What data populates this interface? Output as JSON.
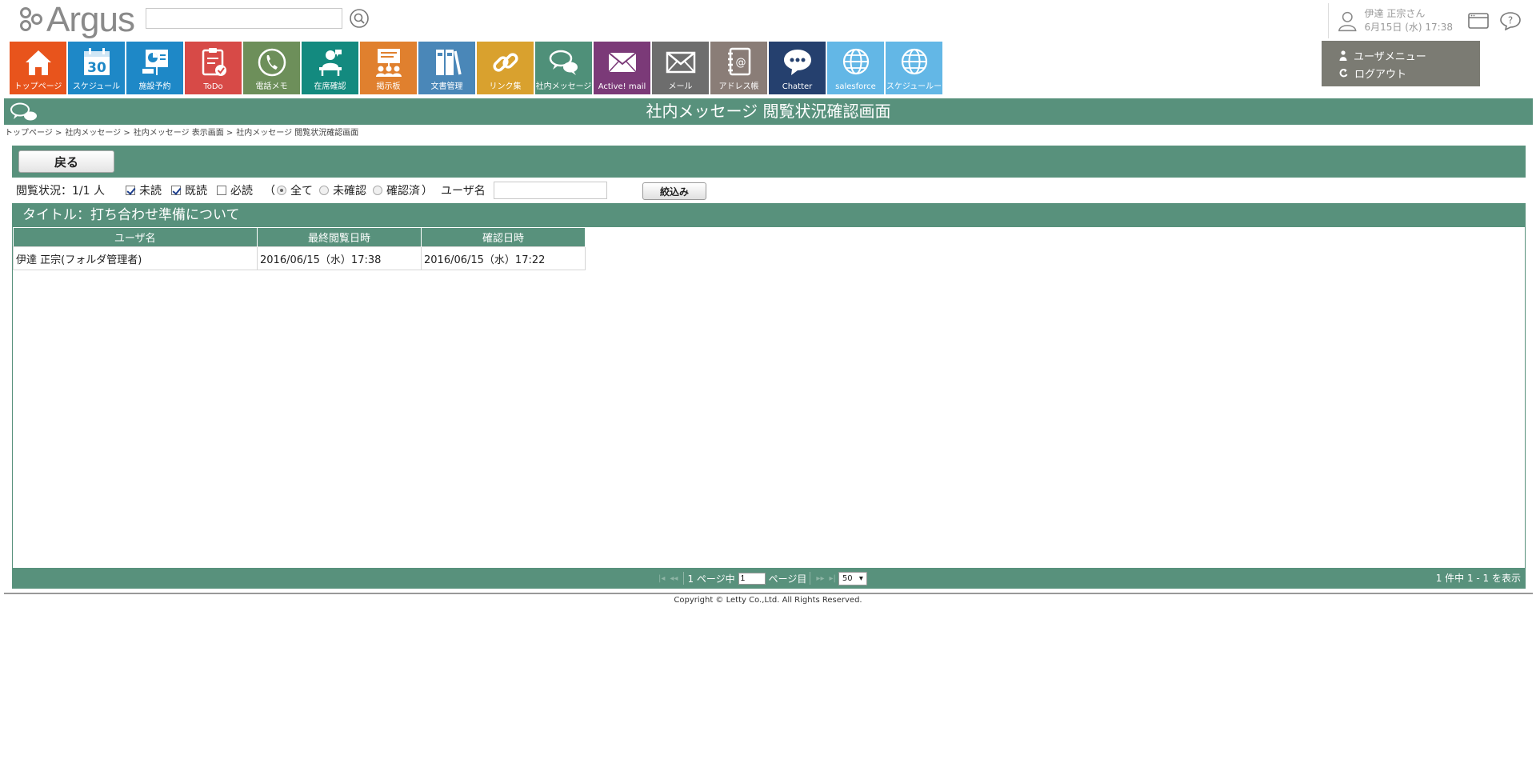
{
  "header": {
    "logo_text": "Argus",
    "search_value": "",
    "user_name": "伊達 正宗さん",
    "user_datetime": "6月15日 (水) 17:38"
  },
  "menu": [
    {
      "label": "トップページ",
      "color": "#e8541c",
      "icon": "home-icon"
    },
    {
      "label": "スケジュール",
      "color": "#1e88c7",
      "icon": "calendar-icon",
      "calendar_day": "30"
    },
    {
      "label": "施設予約",
      "color": "#1e88c7",
      "icon": "facility-icon"
    },
    {
      "label": "ToDo",
      "color": "#d74a47",
      "icon": "todo-icon"
    },
    {
      "label": "電話メモ",
      "color": "#6d8f5a",
      "icon": "phone-icon"
    },
    {
      "label": "在席確認",
      "color": "#138a7f",
      "icon": "presence-icon"
    },
    {
      "label": "掲示板",
      "color": "#e0802e",
      "icon": "board-icon"
    },
    {
      "label": "文書管理",
      "color": "#4a87b8",
      "icon": "document-icon"
    },
    {
      "label": "リンク集",
      "color": "#d9a12e",
      "icon": "link-icon"
    },
    {
      "label": "社内メッセージ",
      "color": "#4f9079",
      "icon": "message-icon"
    },
    {
      "label": "Active! mail",
      "color": "#7b3a78",
      "icon": "active-mail-icon"
    },
    {
      "label": "メール",
      "color": "#6d6d6d",
      "icon": "mail-icon"
    },
    {
      "label": "アドレス帳",
      "color": "#8a7d77",
      "icon": "address-book-icon"
    },
    {
      "label": "Chatter",
      "color": "#25406e",
      "icon": "chatter-icon"
    },
    {
      "label": "salesforce",
      "color": "#63b7e6",
      "icon": "globe-icon"
    },
    {
      "label": "スケジュールー",
      "color": "#63b7e6",
      "icon": "globe-icon"
    }
  ],
  "user_menu": {
    "user_menu_label": "ユーザメニュー",
    "logout_label": "ログアウト"
  },
  "page": {
    "title": "社内メッセージ 閲覧状況確認画面",
    "breadcrumb": [
      "トップページ >",
      "社内メッセージ >",
      "社内メッセージ 表示画面 >",
      "社内メッセージ 閲覧状況確認画面"
    ]
  },
  "toolbar": {
    "back_label": "戻る"
  },
  "filter": {
    "status_label": "閲覧状況：1/1 人",
    "unread_label": "未読",
    "unread_checked": true,
    "read_label": "既読",
    "read_checked": true,
    "required_label": "必読",
    "required_checked": false,
    "paren_open": "（",
    "all_label": "全て",
    "unconfirmed_label": "未確認",
    "confirmed_label": "確認済",
    "paren_close": "）",
    "username_label": "ユーザ名",
    "username_value": "",
    "submit_label": "絞込み"
  },
  "list": {
    "title": "タイトル：打ち合わせ準備について",
    "columns": [
      "ユーザ名",
      "最終閲覧日時",
      "確認日時"
    ],
    "rows": [
      [
        "伊達 正宗(フォルダ管理者)",
        "2016/06/15（水）17:38",
        "2016/06/15（水）17:22"
      ]
    ]
  },
  "pager": {
    "page_prefix": "1 ページ中",
    "current_page": "1",
    "page_suffix": "ページ目",
    "per_page": "50",
    "summary": "1 件中 1 - 1 を表示"
  },
  "footer": {
    "copyright": "Copyright © Letty Co.,Ltd. All Rights Reserved."
  }
}
